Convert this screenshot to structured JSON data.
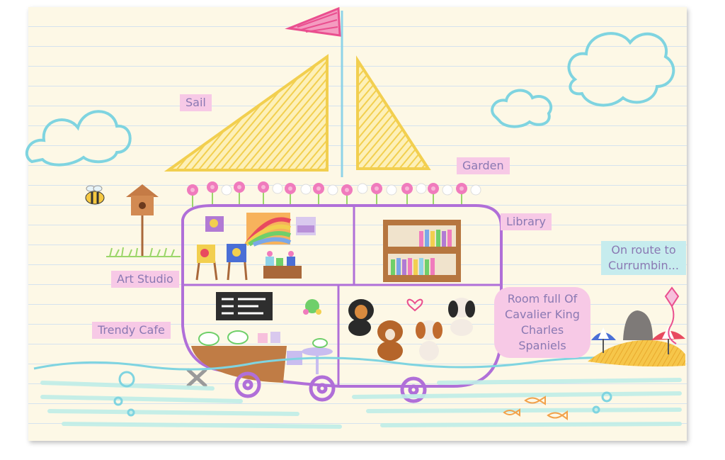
{
  "labels": {
    "sail": "Sail",
    "garden": "Garden",
    "library": "Library",
    "art_studio": "Art Studio",
    "trendy_cafe": "Trendy Cafe",
    "route": "On route to Currumbin...",
    "room": "Room full Of Cavalier King Charles Spaniels"
  },
  "colors": {
    "paper": "#fdf8e6",
    "rule_lines": "#d5e3ef",
    "sail_yellow": "#f2cf4f",
    "boat_outline": "#b06fd8",
    "flag_pink": "#ea4f8f",
    "cloud_blue": "#7fd4e0",
    "label_pink_bg": "#f7c9e6",
    "label_blue_bg": "#c6ecee",
    "label_text": "#8a79b3"
  }
}
